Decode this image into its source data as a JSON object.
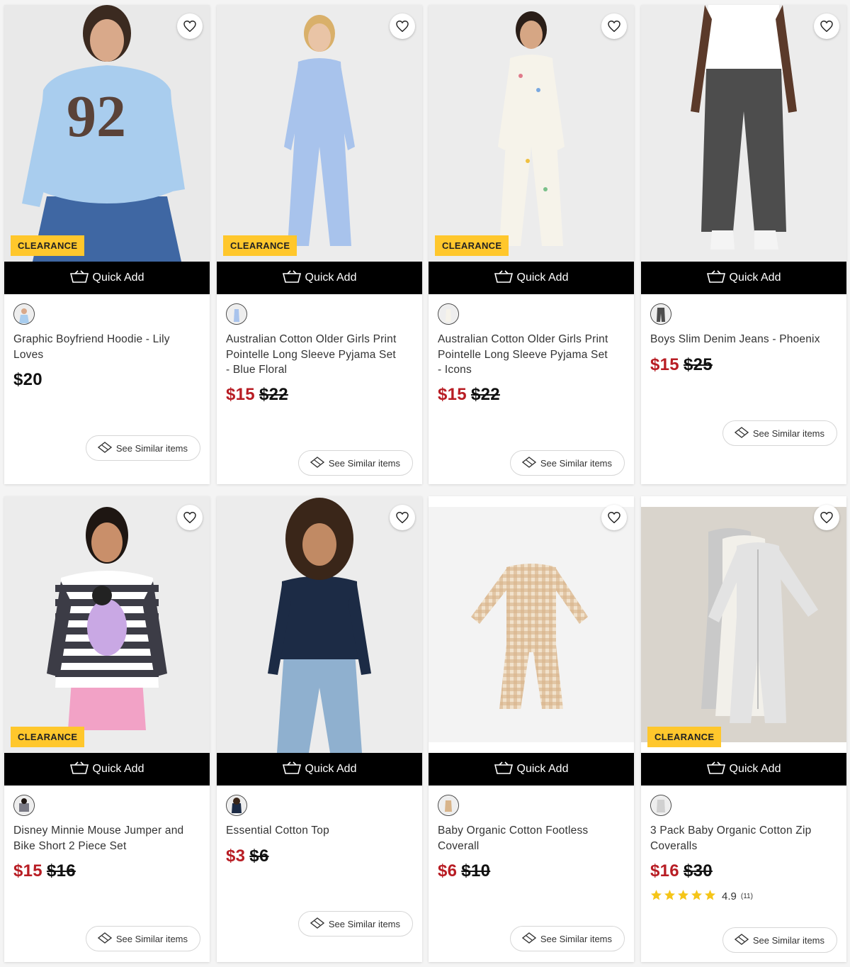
{
  "colors": {
    "sale_price": "#b81d24",
    "badge_bg": "#ffc72c",
    "quick_add_bg": "#000000",
    "star": "#f5c518"
  },
  "quick_add_label": "Quick Add",
  "see_similar_label": "See Similar items",
  "products": [
    {
      "title": "Graphic Boyfriend Hoodie - Lily Loves",
      "badge": "CLEARANCE",
      "price": "$20",
      "was_price": "",
      "image": "girl-blue-92-hoodie"
    },
    {
      "title": "Australian Cotton Older Girls Print Pointelle Long Sleeve Pyjama Set - Blue Floral",
      "badge": "CLEARANCE",
      "price": "$15",
      "was_price": "$22",
      "image": "girl-blue-floral-pyjamas"
    },
    {
      "title": "Australian Cotton Older Girls Print Pointelle Long Sleeve Pyjama Set - Icons",
      "badge": "CLEARANCE",
      "price": "$15",
      "was_price": "$22",
      "image": "girl-white-icon-pyjamas"
    },
    {
      "title": "Boys Slim Denim Jeans - Phoenix",
      "badge": "",
      "price": "$15",
      "was_price": "$25",
      "image": "boy-grey-denim-jeans"
    },
    {
      "title": "Disney Minnie Mouse Jumper and Bike Short 2 Piece Set",
      "badge": "CLEARANCE",
      "price": "$15",
      "was_price": "$16",
      "image": "girl-striped-minnie-jumper"
    },
    {
      "title": "Essential Cotton Top",
      "badge": "",
      "price": "$3",
      "was_price": "$6",
      "image": "girl-navy-cotton-top"
    },
    {
      "title": "Baby Organic Cotton Footless Coverall",
      "badge": "",
      "price": "$6",
      "was_price": "$10",
      "image": "baby-gingham-coverall"
    },
    {
      "title": "3 Pack Baby Organic Cotton Zip Coveralls",
      "badge": "CLEARANCE",
      "price": "$16",
      "was_price": "$30",
      "rating": "4.9",
      "rating_count": "(11)",
      "image": "baby-grey-zip-coveralls"
    }
  ]
}
